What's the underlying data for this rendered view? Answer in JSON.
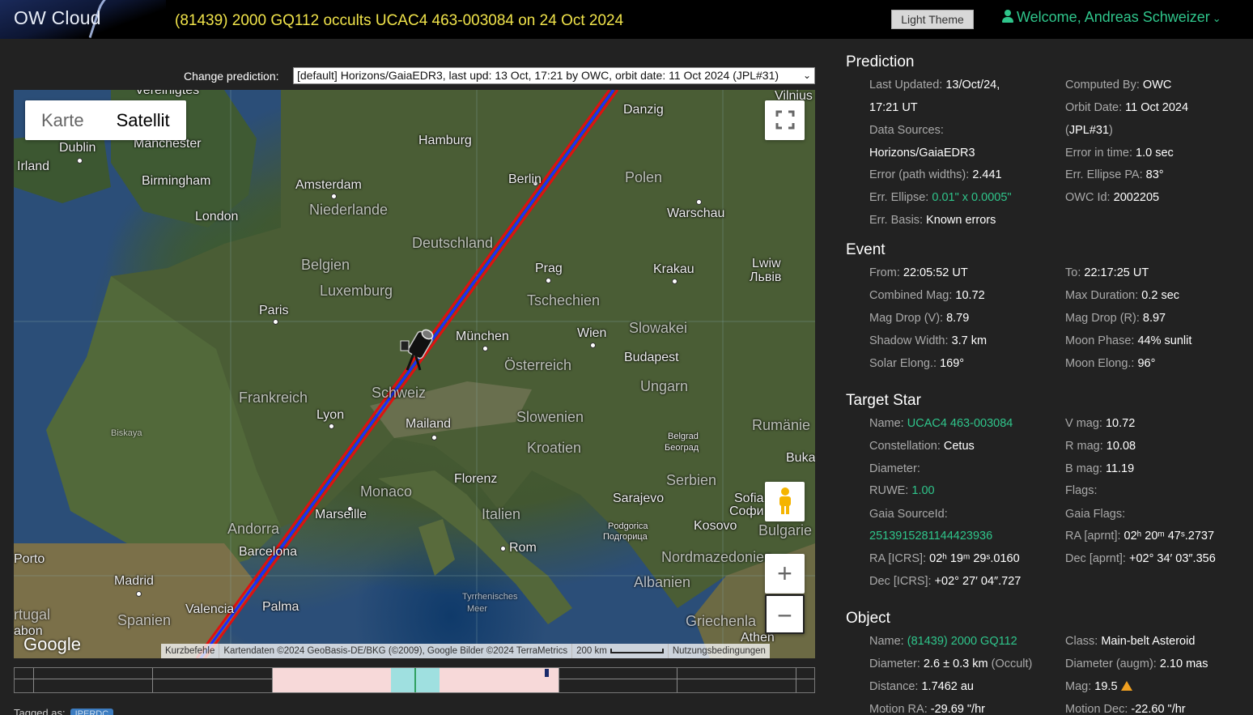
{
  "header": {
    "logo": "OW Cloud",
    "title": "(81439) 2000 GQ112 occults UCAC4 463-003084 on 24 Oct 2024",
    "theme_button": "Light Theme",
    "welcome": "Welcome, Andreas Schweizer"
  },
  "prediction_select": {
    "label": "Change prediction:",
    "value": "[default] Horizons/GaiaEDR3, last upd: 13 Oct, 17:21 by OWC, orbit date: 11 Oct 2024 (JPL#31)"
  },
  "map": {
    "map_types": [
      "Karte",
      "Satellit"
    ],
    "active_type": "Satellit",
    "zoom_in": "+",
    "zoom_out": "−",
    "google": "Google",
    "attribution": {
      "shortcuts": "Kurzbefehle",
      "data": "Kartendaten ©2024 GeoBasis-DE/BKG (©2009), Google Bilder ©2024 TerraMetrics",
      "scale": "200 km",
      "terms": "Nutzungsbedingungen"
    },
    "labels": {
      "vereinigtes": "Vereinigtes",
      "dublin": "Dublin",
      "irland": "Irland",
      "manchester": "Manchester",
      "birmingham": "Birmingham",
      "london": "London",
      "amsterdam": "Amsterdam",
      "niederlande": "Niederlande",
      "hamburg": "Hamburg",
      "berlin": "Berlin",
      "danzig": "Danzig",
      "polen": "Polen",
      "warschau": "Warschau",
      "vilnius": "Vilnius",
      "deutschland": "Deutschland",
      "belgien": "Belgien",
      "luxemburg": "Luxemburg",
      "paris": "Paris",
      "prag": "Prag",
      "tschechien": "Tschechien",
      "krakau": "Krakau",
      "lwiw": "Lwiw",
      "lviv_cyr": "Львів",
      "munchen": "München",
      "wien": "Wien",
      "slowakei": "Slowakei",
      "osterreich": "Österreich",
      "budapest": "Budapest",
      "ungarn": "Ungarn",
      "frankreich": "Frankreich",
      "schweiz": "Schweiz",
      "lyon": "Lyon",
      "mailand": "Mailand",
      "slowenien": "Slowenien",
      "kroatien": "Kroatien",
      "rumanien": "Rumänie",
      "biskaya": "Biskaya",
      "belgrad": "Belgrad",
      "belgrad_cyr": "Београд",
      "buka": "Buka",
      "florenz": "Florenz",
      "monaco": "Monaco",
      "serbien": "Serbien",
      "sarajevo": "Sarajevo",
      "sofia": "Sofia",
      "sofia_cyr": "Софи",
      "marseille": "Marseille",
      "italien": "Italien",
      "andorra": "Andorra",
      "kosovo": "Kosovo",
      "bulgarie": "Bulgarie",
      "podgorica": "Podgorica",
      "podgorica_cyr": "Подгорица",
      "porto": "Porto",
      "barcelona": "Barcelona",
      "rom": "Rom",
      "nordmazedonien": "Nordmazedonien",
      "madrid": "Madrid",
      "albanien": "Albanien",
      "valencia": "Valencia",
      "palma": "Palma",
      "tyrrhenisches": "Tyrrhenisches",
      "meer": "Meer",
      "rtugal": "rtugal",
      "abon": "abon",
      "spanien": "Spanien",
      "griechenla": "Griechenla",
      "athen": "Athen"
    }
  },
  "tagged": {
    "label": "Tagged as:",
    "tag": "IPERDC"
  },
  "prediction": {
    "title": "Prediction",
    "last_updated_k": "Last Updated:",
    "last_updated_v1": "13/Oct/24,",
    "last_updated_v2": "17:21 UT",
    "computed_by_k": "Computed By:",
    "computed_by_v": "OWC",
    "data_sources_k": "Data Sources:",
    "data_sources_v": "Horizons/GaiaEDR3",
    "orbit_date_k": "Orbit Date:",
    "orbit_date_v": "11 Oct 2024",
    "orbit_jpl_open": "(",
    "orbit_jpl_v": "JPL#31",
    "orbit_jpl_close": ")",
    "error_time_k": "Error in time:",
    "error_time_v": "1.0 sec",
    "error_path_k": "Error (path widths):",
    "error_path_v": "2.441",
    "err_pa_k": "Err. Ellipse PA:",
    "err_pa_v": "83°",
    "err_ellipse_k": "Err. Ellipse:",
    "err_ellipse_v": "0.01\" x 0.0005\"",
    "owc_id_k": "OWC Id:",
    "owc_id_v": "2002205",
    "err_basis_k": "Err. Basis:",
    "err_basis_v": "Known errors"
  },
  "event": {
    "title": "Event",
    "from_k": "From:",
    "from_v": "22:05:52 UT",
    "to_k": "To:",
    "to_v": "22:17:25 UT",
    "comb_mag_k": "Combined Mag:",
    "comb_mag_v": "10.72",
    "max_dur_k": "Max Duration:",
    "max_dur_v": "0.2 sec",
    "mag_drop_v_k": "Mag Drop (V):",
    "mag_drop_v_v": "8.79",
    "mag_drop_r_k": "Mag Drop (R):",
    "mag_drop_r_v": "8.97",
    "shadow_k": "Shadow Width:",
    "shadow_v": "3.7 km",
    "moon_phase_k": "Moon Phase:",
    "moon_phase_v": "44% sunlit",
    "solar_k": "Solar Elong.:",
    "solar_v": "169°",
    "moon_elong_k": "Moon Elong.:",
    "moon_elong_v": "96°"
  },
  "target_star": {
    "title": "Target Star",
    "name_k": "Name:",
    "name_v": "UCAC4 463-003084",
    "vmag_k": "V mag:",
    "vmag_v": "10.72",
    "const_k": "Constellation:",
    "const_v": "Cetus",
    "rmag_k": "R mag:",
    "rmag_v": "10.08",
    "diam_k": "Diameter:",
    "bmag_k": "B mag:",
    "bmag_v": "11.19",
    "ruwe_k": "RUWE:",
    "ruwe_v": "1.00",
    "flags_k": "Flags:",
    "gaia_src_k": "Gaia SourceId:",
    "gaia_flags_k": "Gaia Flags:",
    "gaia_src_v": "2513915281144423936",
    "ra_aprnt_k": "RA [aprnt]:",
    "ra_aprnt_v": "02ʰ 20ᵐ 47ˢ.2737",
    "ra_icrs_k": "RA [ICRS]:",
    "ra_icrs_v": "02ʰ 19ᵐ 29ˢ.0160",
    "dec_aprnt_k": "Dec [aprnt]:",
    "dec_aprnt_v": "+02° 34′ 03″.356",
    "dec_icrs_k": "Dec [ICRS]:",
    "dec_icrs_v": "+02° 27′ 04″.727"
  },
  "object": {
    "title": "Object",
    "name_k": "Name:",
    "name_v": "(81439) 2000 GQ112",
    "class_k": "Class:",
    "class_v": "Main-belt Asteroid",
    "diam_k": "Diameter:",
    "diam_v": "2.6 ± 0.3 km",
    "diam_src": "(Occult)",
    "diam_augm_k": "Diameter (augm):",
    "diam_augm_v": "2.10 mas",
    "dist_k": "Distance:",
    "dist_v": "1.7462 au",
    "mag_k": "Mag:",
    "mag_v": "19.5",
    "motion_ra_k": "Motion RA:",
    "motion_ra_v": "-29.69 \"/hr",
    "motion_dec_k": "Motion Dec:",
    "motion_dec_v": "-22.60 \"/hr"
  },
  "colors": {
    "accent_green": "#2fc58b",
    "title_yellow": "#f0e34a",
    "path_red": "#e01010",
    "path_blue": "#1a2cff"
  }
}
